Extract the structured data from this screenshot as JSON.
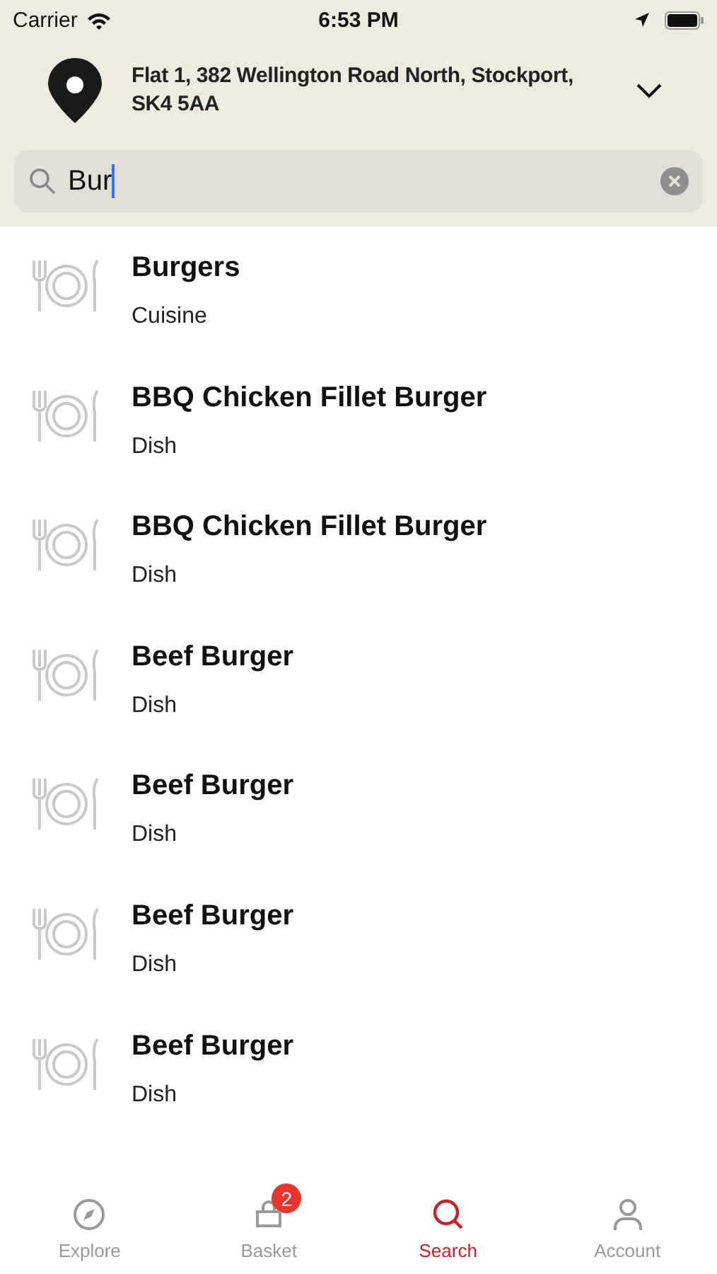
{
  "status_bar": {
    "carrier": "Carrier",
    "time": "6:53 PM"
  },
  "address": {
    "text": "Flat 1, 382 Wellington Road North, Stockport, SK4 5AA"
  },
  "search": {
    "value": "Bur"
  },
  "results": [
    {
      "title": "Burgers",
      "type": "Cuisine"
    },
    {
      "title": "BBQ Chicken Fillet Burger",
      "type": "Dish"
    },
    {
      "title": "BBQ Chicken Fillet Burger",
      "type": "Dish"
    },
    {
      "title": "Beef Burger",
      "type": "Dish"
    },
    {
      "title": "Beef Burger",
      "type": "Dish"
    },
    {
      "title": "Beef Burger",
      "type": "Dish"
    },
    {
      "title": "Beef Burger",
      "type": "Dish"
    }
  ],
  "tabs": [
    {
      "kind": "explore",
      "label": "Explore",
      "selected": false
    },
    {
      "kind": "basket",
      "label": "Basket",
      "selected": false,
      "badge": "2"
    },
    {
      "kind": "search",
      "label": "Search",
      "selected": true
    },
    {
      "kind": "account",
      "label": "Account",
      "selected": false
    }
  ]
}
